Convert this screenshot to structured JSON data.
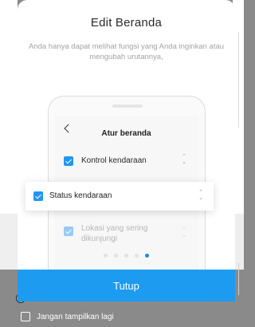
{
  "dialog": {
    "title": "Edit Beranda",
    "subtitle": "Anda hanya dapat melihat fungsi yang Anda inginkan atau mengubah urutannya,"
  },
  "preview": {
    "screen_title": "Atur beranda",
    "items": [
      {
        "label": "Kontrol kendaraan",
        "checked": true
      },
      {
        "label": "Status kendaraan",
        "checked": true
      },
      {
        "label": "Lokasi yang sering dikunjungi",
        "checked": true
      }
    ],
    "sort_icon": "sort-icon",
    "back_icon": "chevron-left-icon"
  },
  "pager": {
    "count": 5,
    "active_index": 4
  },
  "close_button": {
    "label": "Tutup"
  },
  "footer": {
    "checkbox_label": "Jangan tampilkan lagi",
    "checked": false
  },
  "colors": {
    "accent": "#1c9bf0",
    "checkbox": "#2196f3",
    "overlay": "#8a8a8a"
  }
}
